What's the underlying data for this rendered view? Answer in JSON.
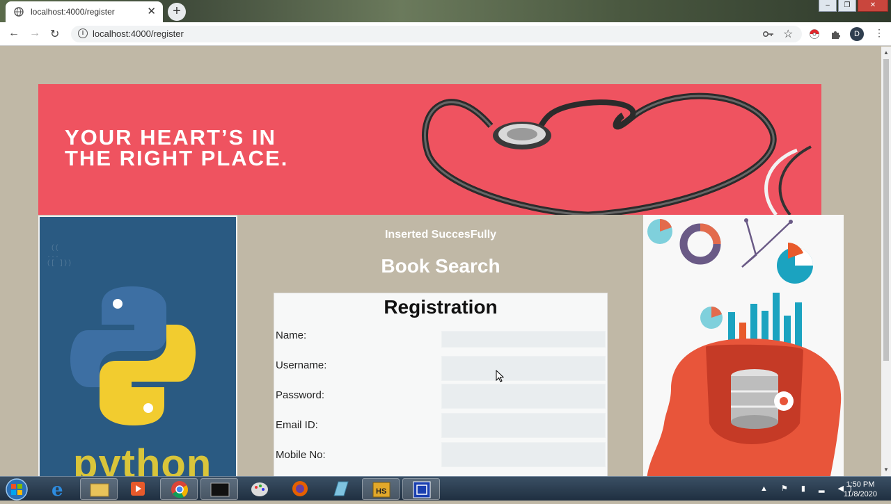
{
  "browser": {
    "tab_title": "localhost:4000/register",
    "close_tab": "✕",
    "new_tab": "+",
    "url": "localhost:4000/register",
    "profile_initial": "D",
    "window_buttons": [
      "–",
      "❐",
      "✕"
    ]
  },
  "banner": {
    "line1": "YOUR HEART’S IN",
    "line2": "THE RIGHT PLACE."
  },
  "left_image": {
    "word": "python"
  },
  "main": {
    "status_message": "Inserted SuccesFully",
    "heading": "Book Search"
  },
  "form": {
    "title": "Registration",
    "fields": [
      {
        "label": "Name:",
        "value": ""
      },
      {
        "label": "Username:",
        "value": ""
      },
      {
        "label": "Password:",
        "value": ""
      },
      {
        "label": "Email ID:",
        "value": ""
      },
      {
        "label": "Mobile No:",
        "value": ""
      }
    ]
  },
  "taskbar": {
    "time": "1:50 PM",
    "date": "11/8/2020",
    "apps": [
      "internet-explorer",
      "file-explorer",
      "media-player",
      "chrome",
      "terminal",
      "paint",
      "firefox",
      "notepad",
      "hs-app",
      "remote-app"
    ]
  },
  "colors": {
    "page_bg": "#c0b8a6",
    "banner_bg": "#ef5360",
    "form_bg": "#f7f8f8"
  }
}
